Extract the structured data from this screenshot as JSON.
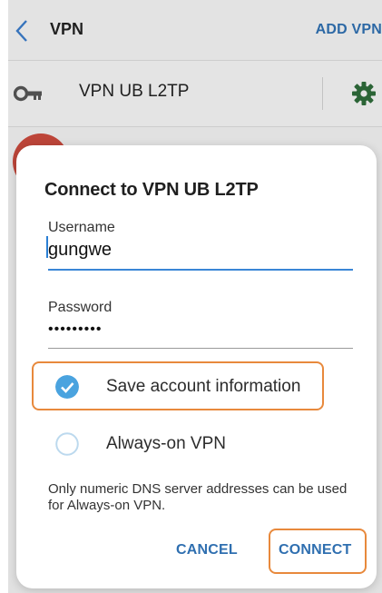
{
  "appbar": {
    "title": "VPN",
    "add_label": "ADD VPN"
  },
  "vpn_list": {
    "items": [
      {
        "name": "VPN UB L2TP"
      }
    ]
  },
  "dialog": {
    "title": "Connect to VPN UB L2TP",
    "username": {
      "label": "Username",
      "value": "gungwe"
    },
    "password": {
      "label": "Password",
      "value": "•••••••••"
    },
    "save_account": {
      "label": "Save account information",
      "checked": true
    },
    "always_on": {
      "label": "Always-on VPN",
      "checked": false
    },
    "note": "Only numeric DNS server addresses can be used for Always-on VPN.",
    "cancel_label": "CANCEL",
    "connect_label": "CONNECT"
  },
  "colors": {
    "accent": "#2f6fb0",
    "check": "#4aa3df",
    "highlight": "#e8893c",
    "gear": "#2e6b3a"
  }
}
